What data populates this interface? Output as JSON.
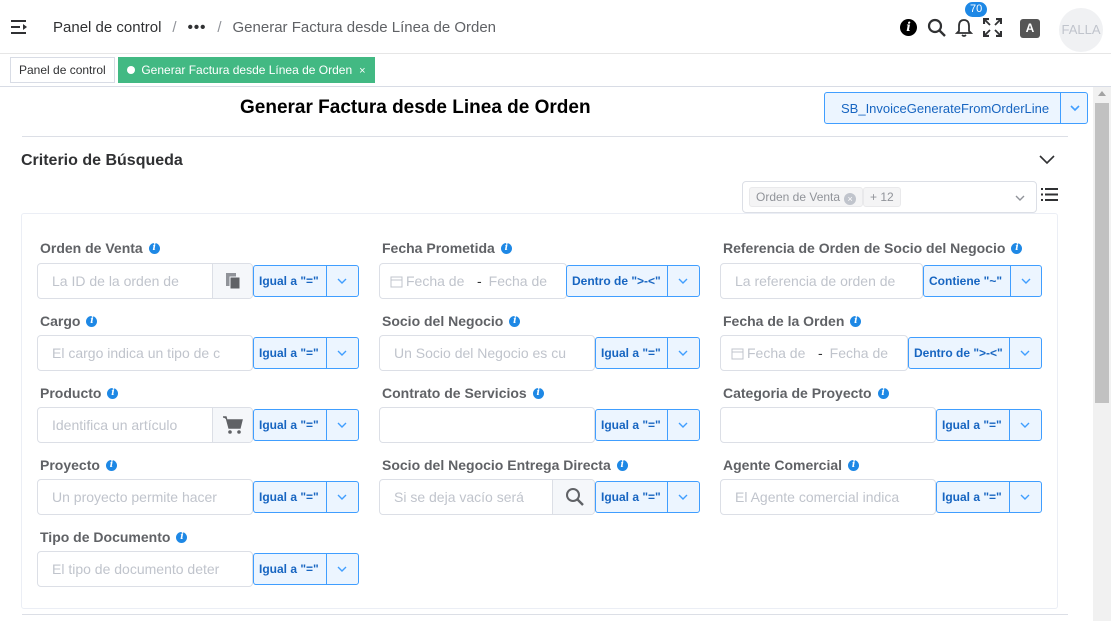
{
  "breadcrumb": {
    "root": "Panel de control",
    "ellipsis": "•••",
    "current": "Generar Factura desde Línea de Orden"
  },
  "header": {
    "notification_count": "70",
    "language_icon_label": "A",
    "avatar_text": "FALLA"
  },
  "tabs": [
    {
      "label": "Panel de control"
    },
    {
      "label": "Generar Factura desde Línea de Orden",
      "close": "×"
    }
  ],
  "page": {
    "title": "Generar Factura desde Linea de Orden",
    "process_value": "SB_InvoiceGenerateFromOrderLine"
  },
  "search": {
    "section_title": "Criterio de Búsqueda",
    "filter_tags": [
      "Orden de Venta",
      "+ 12"
    ],
    "fields": {
      "orden_venta": {
        "label": "Orden de Venta",
        "placeholder": "La ID de la orden de",
        "operator": "Igual a \"=\""
      },
      "fecha_prometida": {
        "label": "Fecha Prometida",
        "from": "Fecha de",
        "to": "Fecha de",
        "dash": "-",
        "operator": "Dentro de \">-<\""
      },
      "referencia": {
        "label": "Referencia de Orden de Socio del Negocio",
        "placeholder": "La referencia de orden de",
        "operator": "Contiene \"~\""
      },
      "cargo": {
        "label": "Cargo",
        "placeholder": "El cargo indica un tipo de c",
        "operator": "Igual a \"=\""
      },
      "socio": {
        "label": "Socio del Negocio",
        "placeholder": "Un Socio del Negocio es cu",
        "operator": "Igual a \"=\""
      },
      "fecha_orden": {
        "label": "Fecha de la Orden",
        "from": "Fecha de",
        "to": "Fecha de",
        "dash": "-",
        "operator": "Dentro de \">-<\""
      },
      "producto": {
        "label": "Producto",
        "placeholder": "Identifica un artículo",
        "operator": "Igual a \"=\""
      },
      "contrato": {
        "label": "Contrato de Servicios",
        "placeholder": "",
        "operator": "Igual a \"=\""
      },
      "categoria": {
        "label": "Categoria de Proyecto",
        "placeholder": "",
        "operator": "Igual a \"=\""
      },
      "proyecto": {
        "label": "Proyecto",
        "placeholder": "Un proyecto permite hacer",
        "operator": "Igual a \"=\""
      },
      "socio_entrega": {
        "label": "Socio del Negocio Entrega Directa",
        "placeholder": "Si se deja vacío será",
        "operator": "Igual a \"=\""
      },
      "agente": {
        "label": "Agente Comercial",
        "placeholder": "El Agente comercial indica",
        "operator": "Igual a \"=\""
      },
      "tipo_documento": {
        "label": "Tipo de Documento",
        "placeholder": "El tipo de documento deter",
        "operator": "Igual a \"=\""
      }
    }
  },
  "colors": {
    "accent": "#409eff",
    "accent_bg": "#ecf5ff",
    "active_tab": "#42b983",
    "help_icon": "#1e88e5"
  }
}
